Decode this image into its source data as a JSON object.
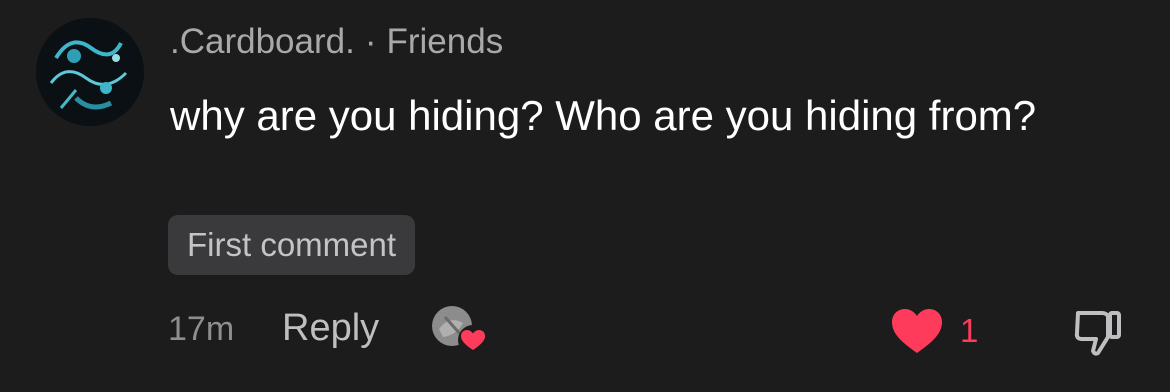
{
  "comment": {
    "username": ".Cardboard.",
    "separator": "·",
    "relationship": "Friends",
    "text": "why are you hiding? Who are you hiding from?",
    "badge": "First comment",
    "timestamp": "17m",
    "reply_label": "Reply",
    "like_count": "1"
  },
  "icons": {
    "avatar": "user-avatar",
    "liker_avatar": "liked-by-creator-avatar",
    "like": "heart-icon",
    "dislike": "thumbs-down-icon"
  },
  "colors": {
    "background": "#1c1c1d",
    "like_accent": "#ff3b5c",
    "badge_bg": "#3a3a3c"
  }
}
